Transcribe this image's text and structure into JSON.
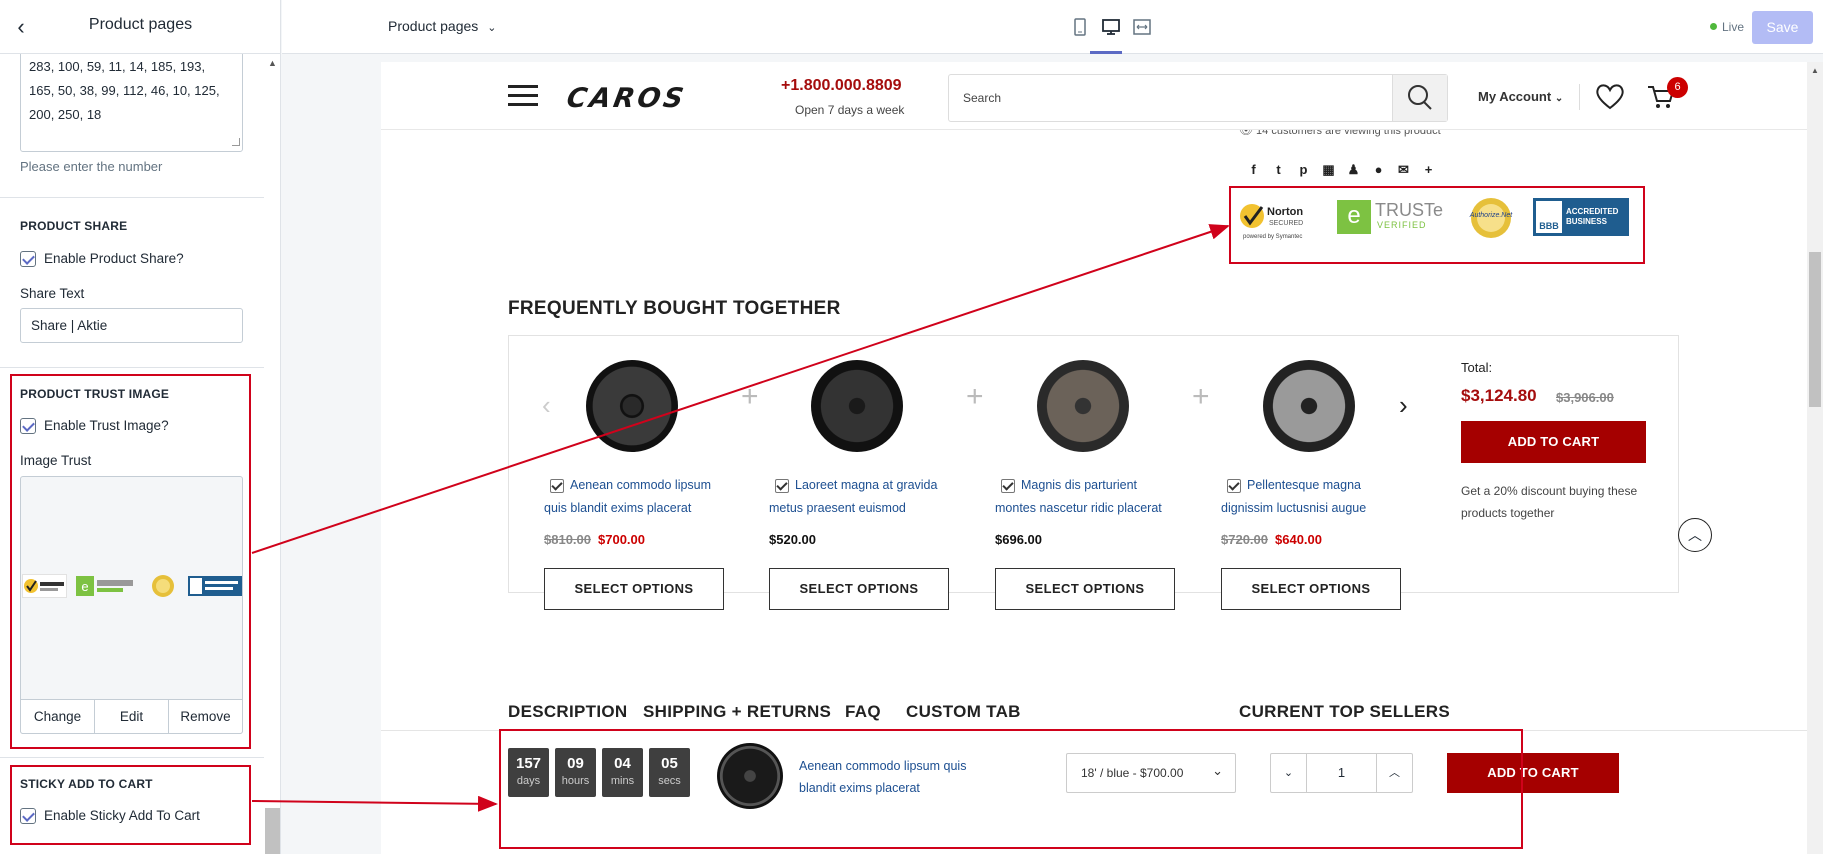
{
  "left_panel": {
    "title": "Product pages",
    "numbers_value_lines": [
      "283, 100, 59, 11, 14, 185, 193,",
      "165, 50, 38, 99, 112, 46, 10, 125,",
      "200, 250, 18"
    ],
    "numbers_hint": "Please enter the number",
    "product_share": {
      "heading": "PRODUCT SHARE",
      "enable_label": "Enable Product Share?",
      "share_text_label": "Share Text",
      "share_text_value": "Share | Aktie"
    },
    "trust_image": {
      "heading": "PRODUCT TRUST IMAGE",
      "enable_label": "Enable Trust Image?",
      "image_label": "Image Trust",
      "change": "Change",
      "edit": "Edit",
      "remove": "Remove"
    },
    "sticky": {
      "heading": "STICKY ADD TO CART",
      "enable_label": "Enable Sticky Add To Cart"
    }
  },
  "topbar": {
    "page_selector": "Product pages",
    "live": "Live",
    "save": "Save"
  },
  "store": {
    "logo": "CAROS",
    "phone": "+1.800.000.8809",
    "phone_sub": "Open 7 days a week",
    "search_placeholder": "Search",
    "my_account": "My Account",
    "cart_count": "6",
    "viewing": "14 customers are viewing this product",
    "trust_badges": {
      "norton": "Norton",
      "norton_sub": "SECURED",
      "norton_powered": "powered by Symantec",
      "truste": "TRUSTe",
      "truste_sub": "VERIFIED",
      "authorize": "Authorize.Net",
      "bbb": "BBB",
      "bbb_text1": "ACCREDITED",
      "bbb_text2": "BUSINESS"
    },
    "fbt": {
      "title": "FREQUENTLY BOUGHT TOGETHER",
      "products": [
        {
          "name1": "Aenean commodo lipsum",
          "name2": "quis blandit exims placerat",
          "old": "$810.00",
          "price": "$700.00",
          "button": "SELECT OPTIONS"
        },
        {
          "name1": "Laoreet magna at gravida",
          "name2": "metus praesent euismod",
          "old": "",
          "price": "$520.00",
          "button": "SELECT OPTIONS"
        },
        {
          "name1": "Magnis dis parturient",
          "name2": "montes nascetur ridic placerat",
          "old": "",
          "price": "$696.00",
          "button": "SELECT OPTIONS"
        },
        {
          "name1": "Pellentesque magna",
          "name2": "dignissim luctusnisi augue",
          "old": "$720.00",
          "price": "$640.00",
          "button": "SELECT OPTIONS"
        }
      ],
      "total_label": "Total:",
      "total_price": "$3,124.80",
      "total_old": "$3,906.00",
      "add_to_cart": "ADD TO CART",
      "discount": "Get a 20% discount buying these products together"
    },
    "tabs": [
      "DESCRIPTION",
      "SHIPPING + RETURNS",
      "FAQ",
      "CUSTOM TAB"
    ],
    "top_sellers": "CURRENT TOP SELLERS",
    "sticky": {
      "countdown": [
        {
          "n": "157",
          "u": "days"
        },
        {
          "n": "09",
          "u": "hours"
        },
        {
          "n": "04",
          "u": "mins"
        },
        {
          "n": "05",
          "u": "secs"
        }
      ],
      "name1": "Aenean commodo lipsum quis",
      "name2": "blandit exims placerat",
      "variant": "18' / blue - $700.00",
      "qty": "1",
      "add_to_cart": "ADD TO CART"
    }
  },
  "colors": {
    "accent": "#5c6ac4",
    "brand_red": "#a50000",
    "annotation_red": "#d0021b",
    "link_blue": "#1d4f91"
  }
}
